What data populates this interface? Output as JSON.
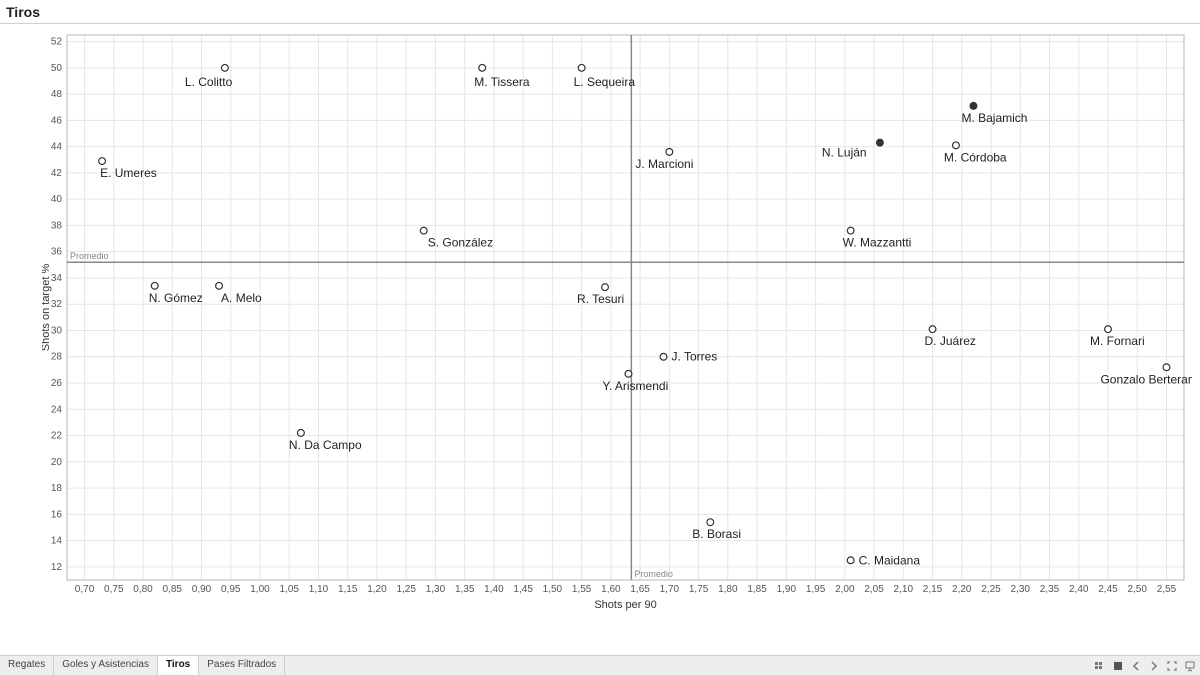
{
  "title": "Tiros",
  "tabs": [
    "Regates",
    "Goles y Asistencias",
    "Tiros",
    "Pases Filtrados"
  ],
  "active_tab": 2,
  "chart_data": {
    "type": "scatter",
    "xlabel": "Shots per 90",
    "ylabel": "Shots on target %",
    "xlim": [
      0.67,
      2.58
    ],
    "ylim": [
      11,
      52.5
    ],
    "xticks": [
      0.7,
      0.75,
      0.8,
      0.85,
      0.9,
      0.95,
      1.0,
      1.05,
      1.1,
      1.15,
      1.2,
      1.25,
      1.3,
      1.35,
      1.4,
      1.45,
      1.5,
      1.55,
      1.6,
      1.65,
      1.7,
      1.75,
      1.8,
      1.85,
      1.9,
      1.95,
      2.0,
      2.05,
      2.1,
      2.15,
      2.2,
      2.25,
      2.3,
      2.35,
      2.4,
      2.45,
      2.5,
      2.55
    ],
    "yticks": [
      12,
      14,
      16,
      18,
      20,
      22,
      24,
      26,
      28,
      30,
      32,
      34,
      36,
      38,
      40,
      42,
      44,
      46,
      48,
      50,
      52
    ],
    "xtick_labels": [
      "0,70",
      "0,75",
      "0,80",
      "0,85",
      "0,90",
      "0,95",
      "1,00",
      "1,05",
      "1,10",
      "1,15",
      "1,20",
      "1,25",
      "1,30",
      "1,35",
      "1,40",
      "1,45",
      "1,50",
      "1,55",
      "1,60",
      "1,65",
      "1,70",
      "1,75",
      "1,80",
      "1,85",
      "1,90",
      "1,95",
      "2,00",
      "2,05",
      "2,10",
      "2,15",
      "2,20",
      "2,25",
      "2,30",
      "2,35",
      "2,40",
      "2,45",
      "2,50",
      "2,55"
    ],
    "ref_x": {
      "value": 1.635,
      "label": "Promedio"
    },
    "ref_y": {
      "value": 35.2,
      "label": "Promedio"
    },
    "series": [
      {
        "name": "players",
        "points": [
          {
            "label": "E. Umeres",
            "x": 0.73,
            "y": 42.9,
            "filled": false,
            "dx": -2,
            "dy": 16
          },
          {
            "label": "N. Gómez",
            "x": 0.82,
            "y": 33.4,
            "filled": false,
            "dx": -6,
            "dy": 16
          },
          {
            "label": "A. Melo",
            "x": 0.93,
            "y": 33.4,
            "filled": false,
            "dx": 2,
            "dy": 16
          },
          {
            "label": "L. Colitto",
            "x": 0.94,
            "y": 50.0,
            "filled": false,
            "dx": -40,
            "dy": 18
          },
          {
            "label": "N. Da Campo",
            "x": 1.07,
            "y": 22.2,
            "filled": false,
            "dx": -12,
            "dy": 16
          },
          {
            "label": "S. González",
            "x": 1.28,
            "y": 37.6,
            "filled": false,
            "dx": 4,
            "dy": 16
          },
          {
            "label": "M. Tissera",
            "x": 1.38,
            "y": 50.0,
            "filled": false,
            "dx": -8,
            "dy": 18
          },
          {
            "label": "L. Sequeira",
            "x": 1.55,
            "y": 50.0,
            "filled": false,
            "dx": -8,
            "dy": 18
          },
          {
            "label": "R. Tesuri",
            "x": 1.59,
            "y": 33.3,
            "filled": false,
            "dx": -28,
            "dy": 16
          },
          {
            "label": "Y. Arismendi",
            "x": 1.63,
            "y": 26.7,
            "filled": false,
            "dx": -26,
            "dy": 16
          },
          {
            "label": "J. Marcioni",
            "x": 1.7,
            "y": 43.6,
            "filled": false,
            "dx": -34,
            "dy": 16
          },
          {
            "label": "J. Torres",
            "x": 1.69,
            "y": 28.0,
            "filled": false,
            "dx": 8,
            "dy": 4
          },
          {
            "label": "B. Borasi",
            "x": 1.77,
            "y": 15.4,
            "filled": false,
            "dx": -18,
            "dy": 16
          },
          {
            "label": "W. Mazzantti",
            "x": 2.01,
            "y": 37.6,
            "filled": false,
            "dx": -8,
            "dy": 16
          },
          {
            "label": "C. Maidana",
            "x": 2.01,
            "y": 12.5,
            "filled": false,
            "dx": 8,
            "dy": 4
          },
          {
            "label": "N. Luján",
            "x": 2.06,
            "y": 44.3,
            "filled": true,
            "dx": -58,
            "dy": 14
          },
          {
            "label": "D. Juárez",
            "x": 2.15,
            "y": 30.1,
            "filled": false,
            "dx": -8,
            "dy": 16
          },
          {
            "label": "M. Córdoba",
            "x": 2.19,
            "y": 44.1,
            "filled": false,
            "dx": -12,
            "dy": 16
          },
          {
            "label": "M. Bajamich",
            "x": 2.22,
            "y": 47.1,
            "filled": true,
            "dx": -12,
            "dy": 16
          },
          {
            "label": "M. Fornari",
            "x": 2.45,
            "y": 30.1,
            "filled": false,
            "dx": -18,
            "dy": 16
          },
          {
            "label": "Gonzalo Berterame",
            "x": 2.55,
            "y": 27.2,
            "filled": false,
            "dx": -66,
            "dy": 16
          }
        ]
      }
    ]
  }
}
